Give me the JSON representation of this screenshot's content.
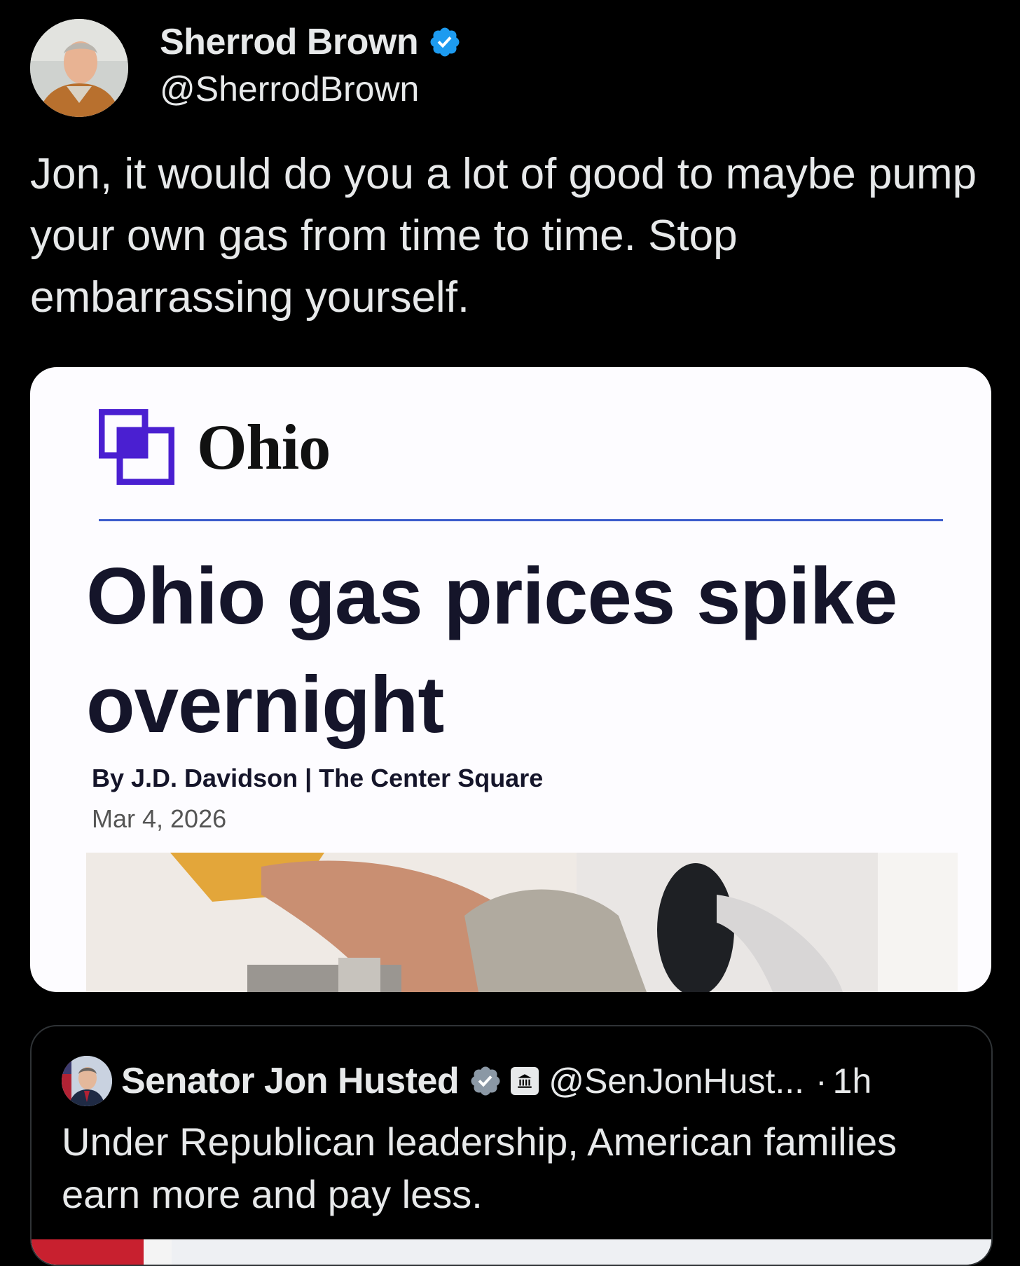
{
  "tweet": {
    "author": {
      "display_name": "Sherrod Brown",
      "handle": "@SherrodBrown",
      "verified": true,
      "avatar": "avatar-photo"
    },
    "text": "Jon, it would do you a lot of good to maybe pump your own gas from time to time. Stop embarrassing yourself.",
    "image_card": {
      "publication": "Ohio",
      "publication_logo": "overlapping-squares-logo",
      "headline": "Ohio gas prices spike overnight",
      "byline": "By J.D. Davidson | The Center Square",
      "date": "Mar 4, 2026",
      "photo": "hand-holding-gas-pump-nozzle"
    }
  },
  "quoted_tweet": {
    "author": {
      "display_name": "Senator Jon Husted",
      "handle": "@SenJonHust...",
      "verified": true,
      "gov_badge": "government-building-icon",
      "avatar": "avatar-photo"
    },
    "separator": "·",
    "time": "1h",
    "text": "Under Republican leadership, American families earn more and pay less."
  },
  "colors": {
    "background": "#000000",
    "text": "#e7e9ea",
    "verified_blue": "#1d9bf0",
    "card_background": "#fdfcff",
    "logo_purple": "#4a1fd1",
    "rule_blue": "#3b5bcc",
    "headline_navy": "#15152a"
  }
}
